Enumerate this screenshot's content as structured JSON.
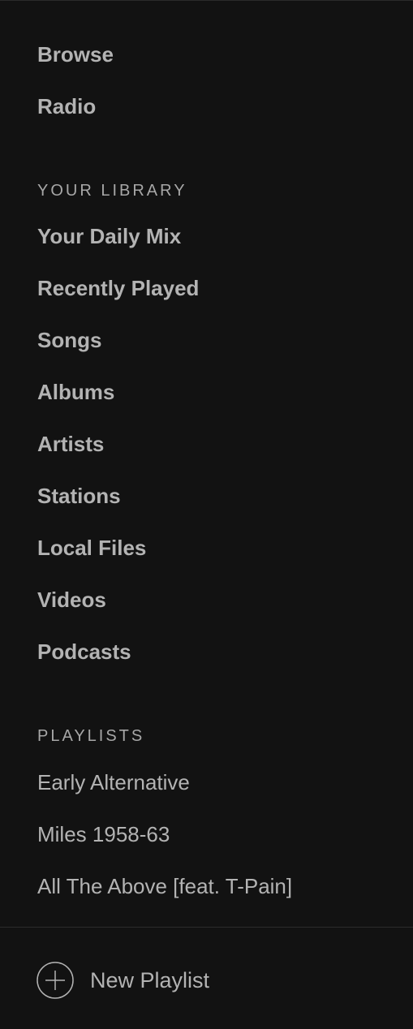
{
  "main_nav": {
    "items": [
      {
        "label": "Browse"
      },
      {
        "label": "Radio"
      }
    ]
  },
  "library": {
    "header": "YOUR LIBRARY",
    "items": [
      {
        "label": "Your Daily Mix"
      },
      {
        "label": "Recently Played"
      },
      {
        "label": "Songs"
      },
      {
        "label": "Albums"
      },
      {
        "label": "Artists"
      },
      {
        "label": "Stations"
      },
      {
        "label": "Local Files"
      },
      {
        "label": "Videos"
      },
      {
        "label": "Podcasts"
      }
    ]
  },
  "playlists": {
    "header": "PLAYLISTS",
    "items": [
      {
        "label": "Early Alternative"
      },
      {
        "label": "Miles 1958-63"
      },
      {
        "label": "All The Above [feat. T-Pain]"
      }
    ]
  },
  "footer": {
    "new_playlist_label": "New Playlist",
    "icon": "plus-circle-icon"
  },
  "colors": {
    "background": "#121212",
    "text": "#b3b3b3",
    "divider": "#2c2c2c"
  }
}
